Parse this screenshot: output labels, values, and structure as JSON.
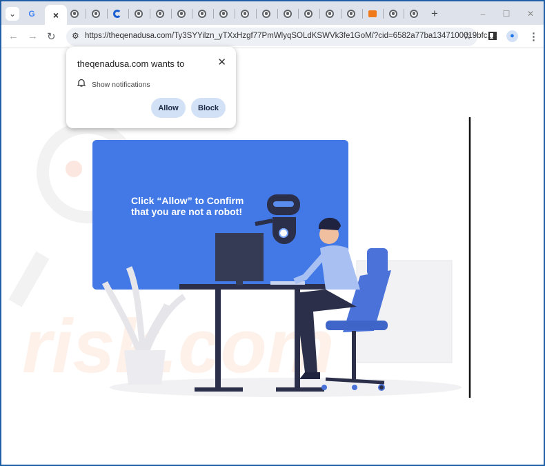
{
  "tabs": {
    "active_close": "×",
    "new_tab": "+",
    "count_globe": 15
  },
  "window": {
    "minimize": "–",
    "maximize": "☐",
    "close": "✕"
  },
  "toolbar": {
    "url": "https://theqenadusa.com/Ty3SYYilzn_yTXxHzgf77PmWlyqSOLdKSWVk3fe1GoM/?cid=6582a77ba1347100019bfc..."
  },
  "popup": {
    "title": "theqenadusa.com wants to",
    "permission": "Show notifications",
    "allow": "Allow",
    "block": "Block",
    "close": "✕"
  },
  "page": {
    "line1_pre": "Click ",
    "line1_bold": "“Allow”",
    "line1_post": " to Confirm",
    "line2": "that you are not a robot!"
  },
  "colors": {
    "card": "#4279e6",
    "button": "#d3e1f7",
    "frame": "#1f5fa8"
  }
}
